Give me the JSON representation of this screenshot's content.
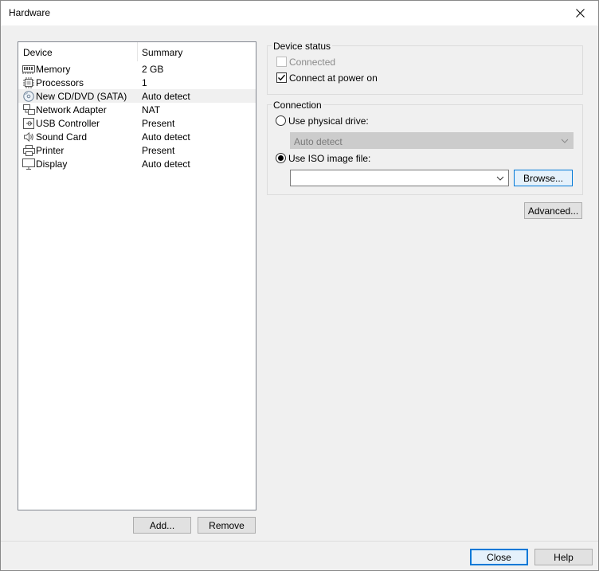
{
  "window": {
    "title": "Hardware"
  },
  "device_list": {
    "headers": {
      "device": "Device",
      "summary": "Summary"
    },
    "rows": [
      {
        "device": "Memory",
        "summary": "2 GB",
        "icon": "memory-icon"
      },
      {
        "device": "Processors",
        "summary": "1",
        "icon": "processor-icon"
      },
      {
        "device": "New CD/DVD (SATA)",
        "summary": "Auto detect",
        "icon": "cd-dvd-icon",
        "selected": true
      },
      {
        "device": "Network Adapter",
        "summary": "NAT",
        "icon": "network-adapter-icon"
      },
      {
        "device": "USB Controller",
        "summary": "Present",
        "icon": "usb-icon"
      },
      {
        "device": "Sound Card",
        "summary": "Auto detect",
        "icon": "sound-card-icon"
      },
      {
        "device": "Printer",
        "summary": "Present",
        "icon": "printer-icon"
      },
      {
        "device": "Display",
        "summary": "Auto detect",
        "icon": "display-icon"
      }
    ]
  },
  "list_buttons": {
    "add": "Add...",
    "remove": "Remove"
  },
  "device_status": {
    "label": "Device status",
    "connected": {
      "label": "Connected",
      "checked": false,
      "disabled": true
    },
    "connect_at_power_on": {
      "label": "Connect at power on",
      "checked": true
    }
  },
  "connection": {
    "label": "Connection",
    "use_physical_drive": {
      "label": "Use physical drive:",
      "selected": false
    },
    "physical_drive_value": "Auto detect",
    "use_iso_image": {
      "label": "Use ISO image file:",
      "selected": true
    },
    "iso_path_value": "",
    "browse": "Browse..."
  },
  "advanced": "Advanced...",
  "footer": {
    "close": "Close",
    "help": "Help"
  }
}
